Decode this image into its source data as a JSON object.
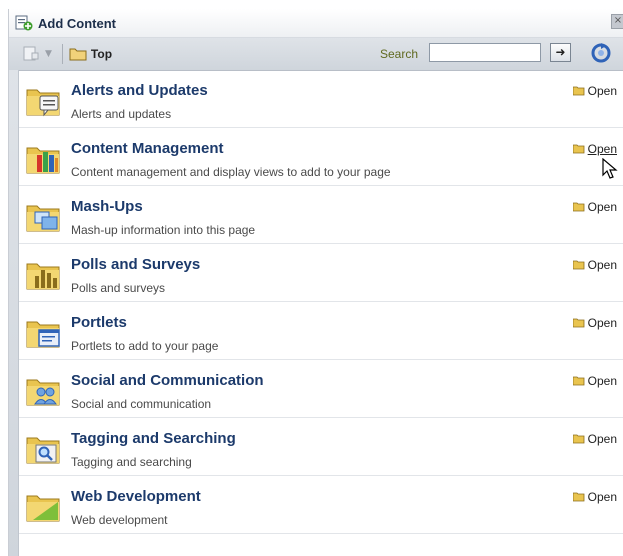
{
  "window": {
    "title": "Add Content"
  },
  "toolbar": {
    "breadcrumb": "Top",
    "search_label": "Search",
    "search_value": ""
  },
  "items": [
    {
      "title": "Alerts and Updates",
      "description": "Alerts and updates",
      "action": "Open",
      "icon": "alerts-folder-icon"
    },
    {
      "title": "Content Management",
      "description": "Content management and display views to add to your page",
      "action": "Open",
      "icon": "content-folder-icon"
    },
    {
      "title": "Mash-Ups",
      "description": "Mash-up information into this page",
      "action": "Open",
      "icon": "mashup-folder-icon"
    },
    {
      "title": "Polls and Surveys",
      "description": "Polls and surveys",
      "action": "Open",
      "icon": "polls-folder-icon"
    },
    {
      "title": "Portlets",
      "description": "Portlets to add to your page",
      "action": "Open",
      "icon": "portlets-folder-icon"
    },
    {
      "title": "Social and Communication",
      "description": "Social and communication",
      "action": "Open",
      "icon": "social-folder-icon"
    },
    {
      "title": "Tagging and Searching",
      "description": "Tagging and searching",
      "action": "Open",
      "icon": "tagging-folder-icon"
    },
    {
      "title": "Web Development",
      "description": "Web development",
      "action": "Open",
      "icon": "webdev-folder-icon"
    }
  ],
  "colors": {
    "title_text": "#1c3a6b",
    "folder": "#e9c44f",
    "toolbar_bg": "#d5dae0"
  }
}
